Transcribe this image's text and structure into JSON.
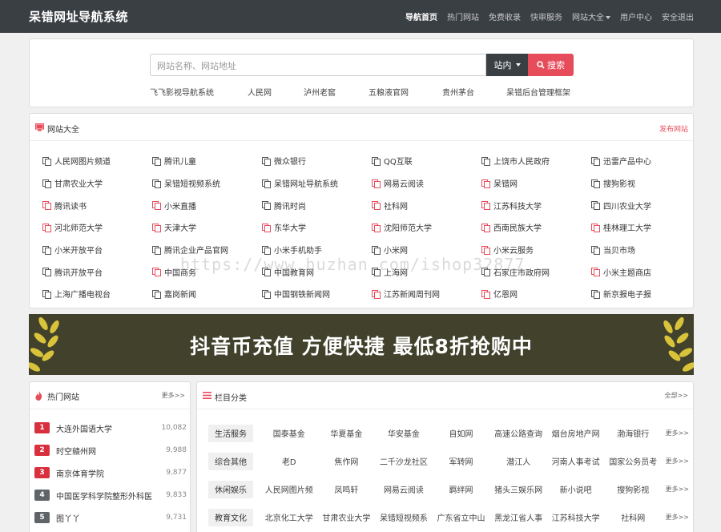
{
  "navbar": {
    "brand": "呆错网址导航系统",
    "links": [
      {
        "label": "导航首页",
        "active": true
      },
      {
        "label": "热门网站"
      },
      {
        "label": "免费收录"
      },
      {
        "label": "快审服务"
      },
      {
        "label": "网站大全",
        "dropdown": true
      },
      {
        "label": "用户中心"
      },
      {
        "label": "安全退出"
      }
    ]
  },
  "search": {
    "placeholder": "网站名称、网站地址",
    "scope_label": "站内",
    "button_label": "搜索",
    "quick_links": [
      "飞飞影视导航系统",
      "人民网",
      "泸州老窖",
      "五粮液官网",
      "贵州茅台",
      "呆错后台管理框架"
    ]
  },
  "sites": {
    "title": "网站大全",
    "action_label": "发布网站",
    "items": [
      {
        "name": "人民网图片频道",
        "red": false
      },
      {
        "name": "腾讯儿童",
        "red": false
      },
      {
        "name": "微众银行",
        "red": false
      },
      {
        "name": "QQ互联",
        "red": false
      },
      {
        "name": "上饶市人民政府",
        "red": false
      },
      {
        "name": "迅雷产品中心",
        "red": false
      },
      {
        "name": "甘肃农业大学",
        "red": false
      },
      {
        "name": "呆错短视频系统",
        "red": false
      },
      {
        "name": "呆错网址导航系统",
        "red": false
      },
      {
        "name": "网易云阅读",
        "red": true
      },
      {
        "name": "呆错网",
        "red": true
      },
      {
        "name": "搜狗影视",
        "red": false
      },
      {
        "name": "腾讯读书",
        "red": true
      },
      {
        "name": "小米直播",
        "red": true
      },
      {
        "name": "腾讯时尚",
        "red": false
      },
      {
        "name": "社科网",
        "red": true
      },
      {
        "name": "江苏科技大学",
        "red": true
      },
      {
        "name": "四川农业大学",
        "red": false
      },
      {
        "name": "河北师范大学",
        "red": true
      },
      {
        "name": "天津大学",
        "red": true
      },
      {
        "name": "东华大学",
        "red": true
      },
      {
        "name": "沈阳师范大学",
        "red": true
      },
      {
        "name": "西南民族大学",
        "red": true
      },
      {
        "name": "桂林理工大学",
        "red": true
      },
      {
        "name": "小米开放平台",
        "red": false
      },
      {
        "name": "腾讯企业产品官网",
        "red": false
      },
      {
        "name": "小米手机助手",
        "red": false
      },
      {
        "name": "小米网",
        "red": false
      },
      {
        "name": "小米云服务",
        "red": true
      },
      {
        "name": "当贝市场",
        "red": false
      },
      {
        "name": "腾讯开放平台",
        "red": false
      },
      {
        "name": "中国商务",
        "red": true
      },
      {
        "name": "中国教育网",
        "red": false
      },
      {
        "name": "上海网",
        "red": false
      },
      {
        "name": "石家庄市政府网",
        "red": false
      },
      {
        "name": "小米主题商店",
        "red": true
      },
      {
        "name": "上海广播电视台",
        "red": false
      },
      {
        "name": "嘉岗新闻",
        "red": false
      },
      {
        "name": "中国钢铁新闻网",
        "red": false
      },
      {
        "name": "江苏新闻周刊网",
        "red": true
      },
      {
        "name": "亿恩网",
        "red": true
      },
      {
        "name": "新京报电子报",
        "red": false
      }
    ]
  },
  "watermark": "https://www.huzhan.com/ishop32877",
  "banner": {
    "text": "抖音币充值 方便快捷 最低8折抢购中"
  },
  "hot": {
    "title": "热门网站",
    "more_label": "更多>>",
    "items": [
      {
        "rank": "1",
        "name": "大连外国语大学",
        "count": "10,082",
        "style": "red"
      },
      {
        "rank": "2",
        "name": "时空赣州网",
        "count": "9,988",
        "style": "red"
      },
      {
        "rank": "3",
        "name": "南京体育学院",
        "count": "9,877",
        "style": "red"
      },
      {
        "rank": "4",
        "name": "中国医学科学院整形外科医",
        "count": "9,833",
        "style": "gray"
      },
      {
        "rank": "5",
        "name": "图丫丫",
        "count": "9,731",
        "style": "gray"
      }
    ]
  },
  "categories": {
    "title": "栏目分类",
    "all_label": "全部>>",
    "more_label": "更多>>",
    "rows": [
      {
        "label": "生活服务",
        "items": [
          "国泰基金",
          "华夏基金",
          "华安基金",
          "自如网",
          "高速公路查询",
          "烟台房地产网",
          "渤海银行"
        ]
      },
      {
        "label": "综合其他",
        "items": [
          "老D",
          "焦作网",
          "二千沙龙社区",
          "军转网",
          "潜江人",
          "河南人事考试",
          "国家公务员考"
        ]
      },
      {
        "label": "休闲娱乐",
        "items": [
          "人民网图片频",
          "凤鸣轩",
          "网易云阅读",
          "羁绊网",
          "猪头三娱乐网",
          "新小说吧",
          "搜狗影视"
        ]
      },
      {
        "label": "教育文化",
        "items": [
          "北京化工大学",
          "甘肃农业大学",
          "呆错短视频系",
          "广东省立中山",
          "黑龙江省人事",
          "江苏科技大学",
          "社科网"
        ]
      }
    ]
  },
  "colors": {
    "navbar_bg": "#3a3f44",
    "accent_red": "#e74c5b",
    "banner_bg": "#41412c"
  }
}
